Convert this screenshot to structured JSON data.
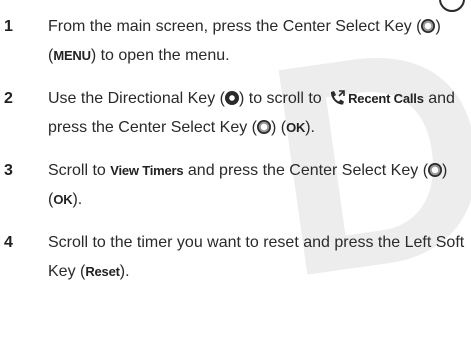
{
  "watermark": "D",
  "steps": [
    {
      "number": "1",
      "t1": "From the main screen, press the Center Select Key (",
      "t2": ") (",
      "key1": "MENU",
      "t3": ") to open the menu."
    },
    {
      "number": "2",
      "t1": "Use the Directional Key (",
      "t2": ") to scroll to ",
      "key1": "Recent Calls",
      "t3": " and press the Center Select Key (",
      "t4": ") (",
      "key2": "OK",
      "t5": ")."
    },
    {
      "number": "3",
      "t1": "Scroll to ",
      "key1": "View Timers",
      "t2": " and press the Center Select Key (",
      "t3": ") (",
      "key2": "OK",
      "t4": ")."
    },
    {
      "number": "4",
      "t1": "Scroll to the timer you want to reset and press the Left Soft Key (",
      "key1": "Reset",
      "t2": ")."
    }
  ]
}
